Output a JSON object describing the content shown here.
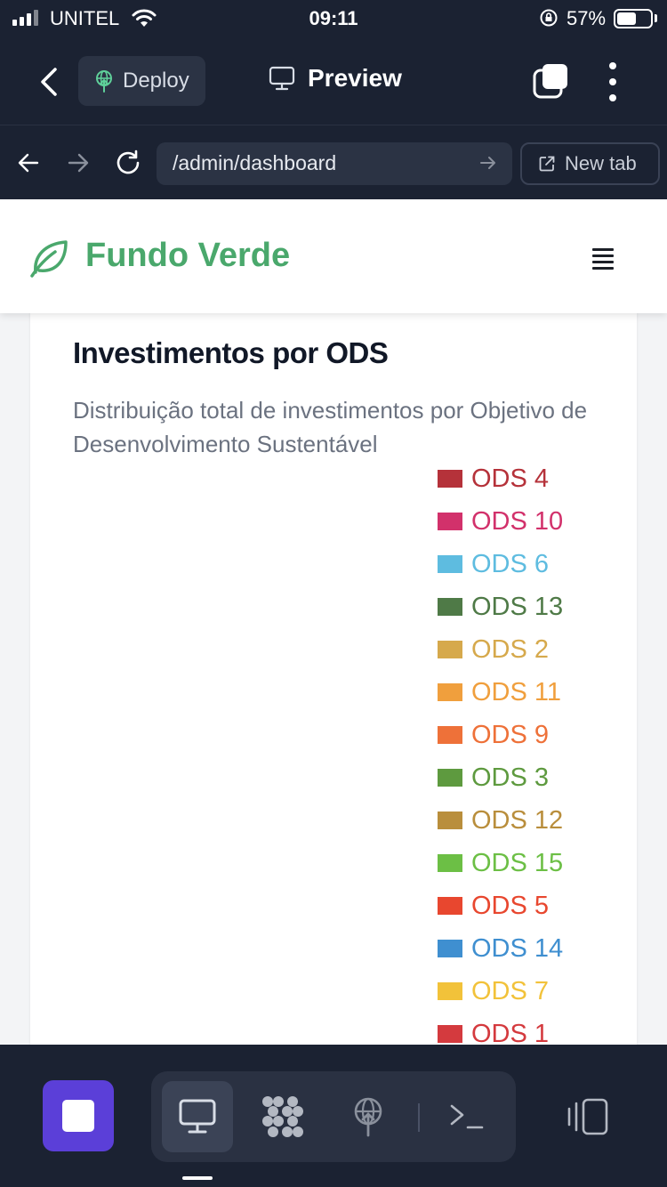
{
  "status": {
    "carrier": "UNITEL",
    "time": "09:11",
    "battery_percent": "57%",
    "battery_level": 0.57
  },
  "toolbar": {
    "deploy_label": "Deploy",
    "preview_label": "Preview"
  },
  "browser": {
    "url": "/admin/dashboard",
    "new_tab_label": "New tab"
  },
  "site": {
    "brand": "Fundo Verde"
  },
  "card": {
    "title": "Investimentos por ODS",
    "subtitle": "Distribuição total de investimentos por Objetivo de Desenvolvimento Sustentável"
  },
  "chart_data": {
    "type": "pie",
    "legend_position": "right",
    "legend": [
      {
        "label": "ODS 4",
        "color": "#b5323a"
      },
      {
        "label": "ODS 10",
        "color": "#d2316b"
      },
      {
        "label": "ODS 6",
        "color": "#5ebce0"
      },
      {
        "label": "ODS 13",
        "color": "#4f7a47"
      },
      {
        "label": "ODS 2",
        "color": "#d6a94c"
      },
      {
        "label": "ODS 11",
        "color": "#f09f3d"
      },
      {
        "label": "ODS 9",
        "color": "#ee7139"
      },
      {
        "label": "ODS 3",
        "color": "#5e9a3f"
      },
      {
        "label": "ODS 12",
        "color": "#b98e3c"
      },
      {
        "label": "ODS 15",
        "color": "#6cbf45"
      },
      {
        "label": "ODS 5",
        "color": "#e8472f"
      },
      {
        "label": "ODS 14",
        "color": "#3f8fd0"
      },
      {
        "label": "ODS 7",
        "color": "#f2c23a"
      },
      {
        "label": "ODS 1",
        "color": "#d43a3e"
      }
    ]
  }
}
